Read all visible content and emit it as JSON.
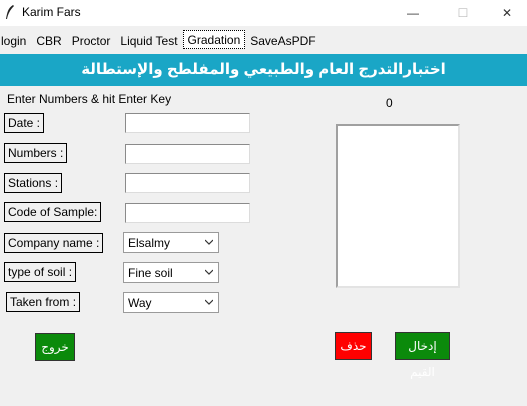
{
  "window": {
    "title": "Karim Fars",
    "feather_icon": "feather-icon",
    "minimize_glyph": "—",
    "maximize_glyph": "☐",
    "close_glyph": "✕"
  },
  "tabs": [
    {
      "label": "login"
    },
    {
      "label": "CBR"
    },
    {
      "label": "Proctor"
    },
    {
      "label": "Liquid Test"
    },
    {
      "label": "Gradation",
      "active": true
    },
    {
      "label": "SaveAsPDF"
    }
  ],
  "banner": {
    "title": "اختبارالتدرج العام والطبيعي والمفلطح والإستطالة",
    "color": "#1aa6c6"
  },
  "form": {
    "hint": "Enter Numbers & hit Enter Key",
    "counter": "0",
    "date_label": "Date :",
    "numbers_label": "Numbers :",
    "stations_label": "Stations :",
    "code_label": "Code of Sample:",
    "company_label": "Company name :",
    "soil_label": "type of soil :",
    "taken_label": "Taken from :",
    "date_value": "",
    "numbers_value": "",
    "stations_value": "",
    "code_value": "",
    "company_value": "Elsalmy",
    "soil_value": "Fine soil",
    "taken_value": "Way"
  },
  "buttons": {
    "exit_label": "خروج",
    "delete_label": "حذف",
    "enter_label": "إدخال القيم",
    "exit_color": "#0b8a0b",
    "delete_color": "#ff0000",
    "enter_color": "#0b8a0b"
  }
}
